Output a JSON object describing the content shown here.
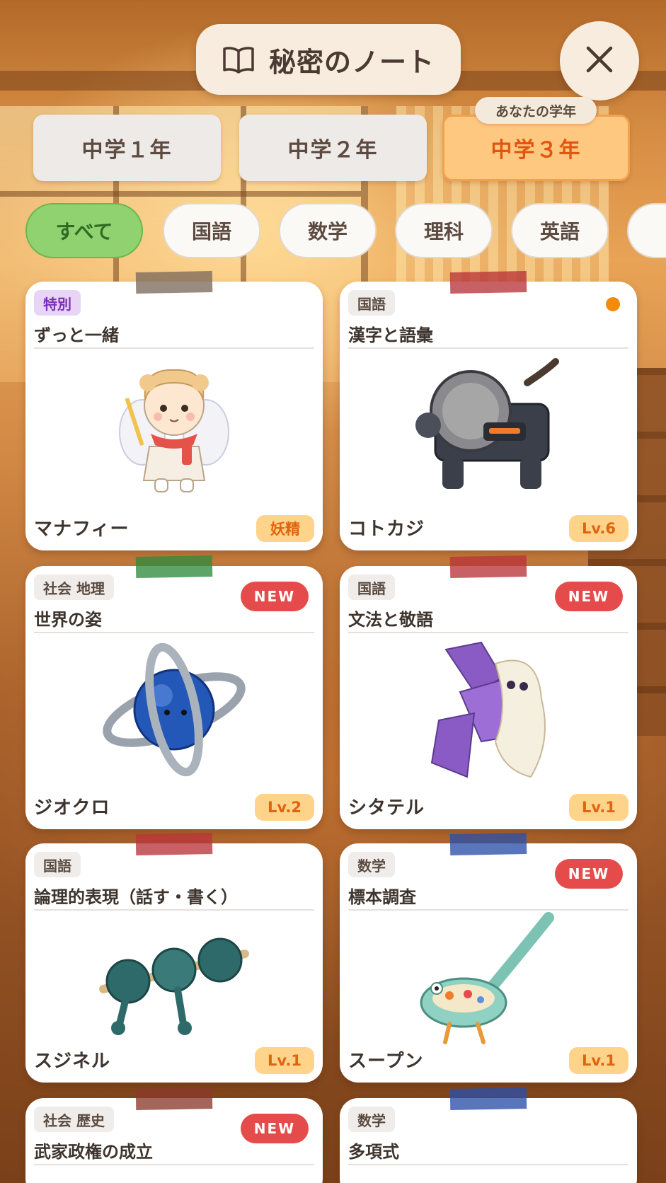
{
  "header": {
    "title": "秘密のノート",
    "book_icon": "book-open-icon",
    "close_icon": "close-icon"
  },
  "grades": {
    "badge": "あなたの学年",
    "tabs": [
      {
        "label": "中学１年",
        "active": false
      },
      {
        "label": "中学２年",
        "active": false
      },
      {
        "label": "中学３年",
        "active": true
      }
    ]
  },
  "subjects": [
    {
      "label": "すべて",
      "active": true
    },
    {
      "label": "国語",
      "active": false
    },
    {
      "label": "数学",
      "active": false
    },
    {
      "label": "理科",
      "active": false
    },
    {
      "label": "英語",
      "active": false
    }
  ],
  "cards": [
    {
      "tag": "特別",
      "title": "ずっと一緒",
      "name": "マナフィー",
      "badge": "妖精",
      "new": false,
      "dot": false,
      "tape_color": "#7d6a5c",
      "art": "fairy-character-icon"
    },
    {
      "tag": "国語",
      "title": "漢字と語彙",
      "name": "コトカジ",
      "badge": "Lv.6",
      "new": false,
      "dot": true,
      "tape_color": "#b8343a",
      "art": "forge-machine-creature-icon"
    },
    {
      "tag": "社会 地理",
      "title": "世界の姿",
      "name": "ジオクロ",
      "badge": "Lv.2",
      "new": true,
      "dot": false,
      "tape_color": "#2f8a3e",
      "art": "globe-rings-creature-icon"
    },
    {
      "tag": "国語",
      "title": "文法と敬語",
      "name": "シタテル",
      "badge": "Lv.1",
      "new": true,
      "dot": false,
      "tape_color": "#b8343a",
      "art": "origami-ghost-creature-icon"
    },
    {
      "tag": "国語",
      "title": "論理的表現（話す・書く）",
      "name": "スジネル",
      "badge": "Lv.1",
      "new": false,
      "dot": false,
      "tape_color": "#b8343a",
      "art": "knotted-rope-creature-icon"
    },
    {
      "tag": "数学",
      "title": "標本調査",
      "name": "スープン",
      "badge": "Lv.1",
      "new": true,
      "dot": false,
      "tape_color": "#2a4fa8",
      "art": "ladle-creature-icon"
    },
    {
      "tag": "社会 歴史",
      "title": "武家政権の成立",
      "name": "",
      "badge": "",
      "new": true,
      "dot": false,
      "tape_color": "#8a3a2c",
      "art": ""
    },
    {
      "tag": "数学",
      "title": "多項式",
      "name": "",
      "badge": "",
      "new": false,
      "dot": false,
      "tape_color": "#2a4fa8",
      "art": ""
    }
  ],
  "new_label": "NEW",
  "colors": {
    "accent_orange": "#e0560f",
    "active_chip_green": "#8fd26f",
    "new_red": "#e64b4b",
    "level_bg": "#ffd389"
  }
}
